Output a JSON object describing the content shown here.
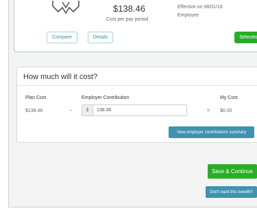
{
  "plan": {
    "icon": "medical-plan-icon",
    "price": "$138.46",
    "price_sub": "Cost per pay period",
    "effective": "Effective on 08/01/18",
    "tier": "Employee",
    "compare_label": "Compare",
    "details_label": "Details",
    "selected_label": "Selected"
  },
  "cost": {
    "title": "How much will it cost?",
    "headers": {
      "plan_cost": "Plan Cost",
      "employer_contribution": "Employer Contribution",
      "my_cost": "My Cost"
    },
    "plan_cost_value": "$138.46",
    "minus": "−",
    "employer_prefix": "$",
    "employer_value": "138.46",
    "equals": "=",
    "my_cost_value": "$0.00"
  },
  "actions": {
    "summary_label": "View employer contributions summary",
    "continue_label": "Save & Continue",
    "dont_want_label": "Don't want this benefit?"
  },
  "colors": {
    "accent_green": "#27ae27",
    "accent_teal": "#3f93b0",
    "card_border": "#9fd4dc"
  }
}
